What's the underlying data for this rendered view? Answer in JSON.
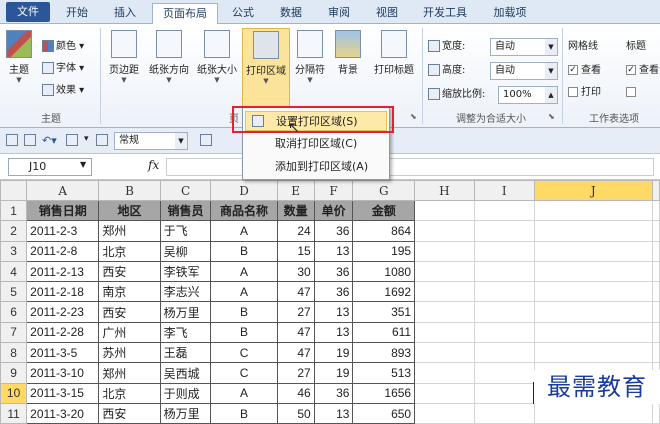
{
  "ribbon_tabs": [
    "文件",
    "开始",
    "插入",
    "页面布局",
    "公式",
    "数据",
    "审阅",
    "视图",
    "开发工具",
    "加载项"
  ],
  "ribbon": {
    "theme": {
      "main": "主题",
      "colors": "颜色",
      "fonts": "字体",
      "effects": "效果",
      "group": "主题"
    },
    "page_setup": {
      "margins": "页边距",
      "orientation": "纸张方向",
      "size": "纸张大小",
      "print_area": "打印区域",
      "breaks": "分隔符",
      "background": "背景",
      "print_titles": "打印标题",
      "group_fragment": "页"
    },
    "scale": {
      "width_label": "宽度:",
      "width_value": "自动",
      "height_label": "高度:",
      "height_value": "自动",
      "scale_label": "缩放比例:",
      "scale_value": "100%",
      "group": "调整为合适大小"
    },
    "sheet_options": {
      "gridlines": "网格线",
      "headings": "标题",
      "view": "查看",
      "print": "打印",
      "group": "工作表选项"
    }
  },
  "qat": {
    "style_value": "常规"
  },
  "formula_bar": {
    "name_box": "J10",
    "fx": "fx"
  },
  "dropdown_menu": {
    "items": [
      "设置打印区域(S)",
      "取消打印区域(C)",
      "添加到打印区域(A)"
    ]
  },
  "sheet": {
    "columns": [
      "A",
      "B",
      "C",
      "D",
      "E",
      "F",
      "G",
      "H",
      "I",
      "J"
    ],
    "rows": [
      {
        "n": "1",
        "cells": [
          "销售日期",
          "地区",
          "销售员",
          "商品名称",
          "数量",
          "单价",
          "金额"
        ]
      },
      {
        "n": "2",
        "cells": [
          "2011-2-3",
          "郑州",
          "于飞",
          "A",
          "24",
          "36",
          "864"
        ]
      },
      {
        "n": "3",
        "cells": [
          "2011-2-8",
          "北京",
          "吴柳",
          "B",
          "15",
          "13",
          "195"
        ]
      },
      {
        "n": "4",
        "cells": [
          "2011-2-13",
          "西安",
          "李铁军",
          "A",
          "30",
          "36",
          "1080"
        ]
      },
      {
        "n": "5",
        "cells": [
          "2011-2-18",
          "南京",
          "李志兴",
          "A",
          "47",
          "36",
          "1692"
        ]
      },
      {
        "n": "6",
        "cells": [
          "2011-2-23",
          "西安",
          "杨万里",
          "B",
          "27",
          "13",
          "351"
        ]
      },
      {
        "n": "7",
        "cells": [
          "2011-2-28",
          "广州",
          "李飞",
          "B",
          "47",
          "13",
          "611"
        ]
      },
      {
        "n": "8",
        "cells": [
          "2011-3-5",
          "苏州",
          "王磊",
          "C",
          "47",
          "19",
          "893"
        ]
      },
      {
        "n": "9",
        "cells": [
          "2011-3-10",
          "郑州",
          "吴西城",
          "C",
          "27",
          "19",
          "513"
        ]
      },
      {
        "n": "10",
        "cells": [
          "2011-3-15",
          "北京",
          "于则成",
          "A",
          "46",
          "36",
          "1656"
        ]
      },
      {
        "n": "11",
        "cells": [
          "2011-3-20",
          "西安",
          "杨万里",
          "B",
          "50",
          "13",
          "650"
        ]
      }
    ]
  },
  "watermark": "最需教育",
  "colors": {
    "accent": "#2b579a",
    "selection": "#ffd966",
    "highlight_box": "#e0242f"
  }
}
